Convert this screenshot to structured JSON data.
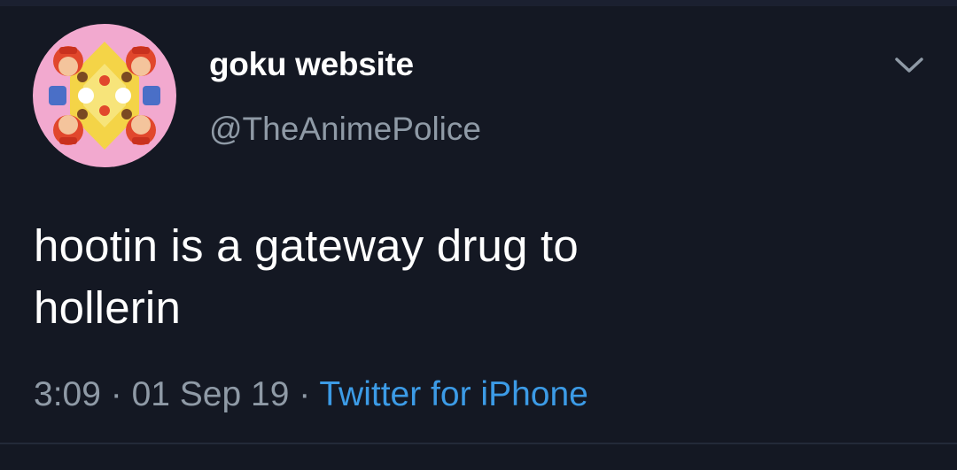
{
  "user": {
    "display_name": "goku website",
    "handle": "@TheAnimePolice",
    "avatar": "mirrored-mario-kaleidoscope-avatar"
  },
  "tweet": {
    "text_line1": "hootin is a gateway drug to",
    "text_line2": "hollerin"
  },
  "meta": {
    "time": "3:09",
    "separator1": " · ",
    "date": "01 Sep 19",
    "separator2": " · ",
    "source": "Twitter for iPhone"
  },
  "icons": {
    "menu": "chevron-down-icon"
  },
  "colors": {
    "background": "#141823",
    "text": "#ffffff",
    "secondary_text": "#8f9aa6",
    "link": "#3c9be6"
  }
}
